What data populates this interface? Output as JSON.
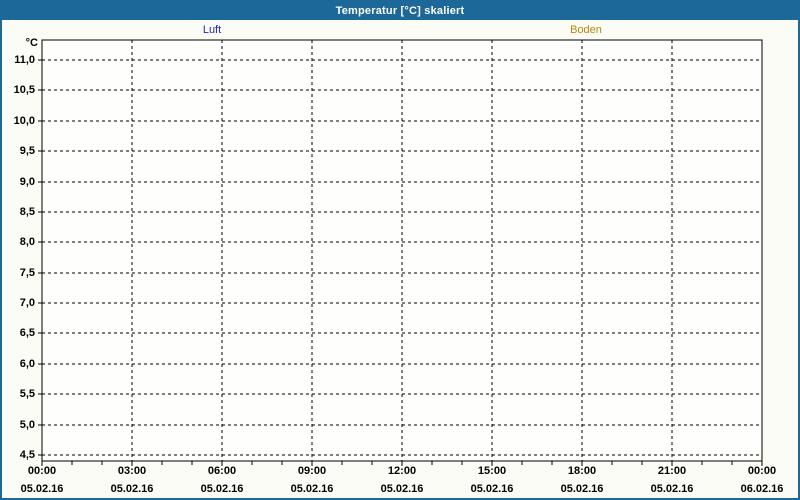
{
  "window": {
    "title": "Temperatur [°C] skaliert"
  },
  "colors": {
    "accent": "#1C6899",
    "window_bg": "#FBFCF5",
    "plot_bg": "#FEFEFC",
    "grid": "#000000",
    "axis": "#000000",
    "title_text": "#FFFFFF",
    "luft_series": "#2222CC",
    "boden_series": "#B8860B"
  },
  "legend": [
    {
      "label": "Luft",
      "color": "#2222CC"
    },
    {
      "label": "Boden",
      "color": "#B8860B"
    }
  ],
  "chart_data": {
    "type": "line",
    "title": "Temperatur [°C] skaliert",
    "unit": "°C",
    "grid": {
      "style": "dashed",
      "color": "#000000"
    },
    "legend_position": "top",
    "y_axis": {
      "min": 4.5,
      "max": 11.0,
      "step": 0.5,
      "tick_labels": [
        "11,0",
        "10,5",
        "10,0",
        "9,5",
        "9,0",
        "8,5",
        "8,0",
        "7,5",
        "7,0",
        "6,5",
        "6,0",
        "5,5",
        "5,0",
        "4,5"
      ]
    },
    "x_axis": {
      "minor_ticks_per_major": 3,
      "tick_labels": [
        {
          "time": "00:00",
          "date": "05.02.16"
        },
        {
          "time": "03:00",
          "date": "05.02.16"
        },
        {
          "time": "06:00",
          "date": "05.02.16"
        },
        {
          "time": "09:00",
          "date": "05.02.16"
        },
        {
          "time": "12:00",
          "date": "05.02.16"
        },
        {
          "time": "15:00",
          "date": "05.02.16"
        },
        {
          "time": "18:00",
          "date": "05.02.16"
        },
        {
          "time": "21:00",
          "date": "05.02.16"
        },
        {
          "time": "00:00",
          "date": "06.02.16"
        }
      ]
    },
    "series": [
      {
        "name": "Luft",
        "color": "#2222CC",
        "values": []
      },
      {
        "name": "Boden",
        "color": "#B8860B",
        "values": []
      }
    ]
  }
}
